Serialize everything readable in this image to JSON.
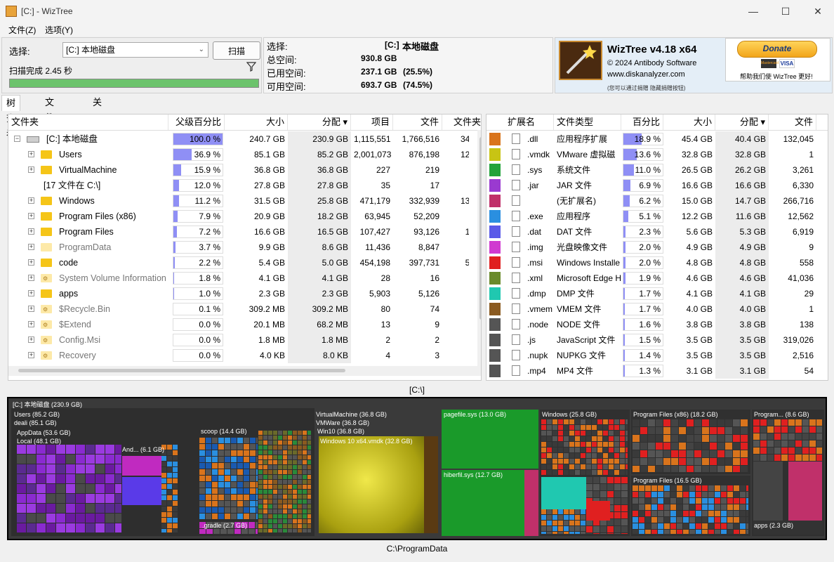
{
  "window": {
    "title": "[C:]  - WizTree",
    "minimize_icon": "minimize-icon",
    "maximize_icon": "maximize-icon",
    "close_icon": "close-icon"
  },
  "menu": [
    "文件(Z)",
    "选项(Y)"
  ],
  "scan_panel": {
    "select_label": "选择:",
    "drive_value": "[C:] 本地磁盘",
    "scan_button": "扫描",
    "status": "扫描完成 2.45 秒",
    "progress_fraction": 1.0,
    "filter_icon": "filter-icon"
  },
  "drive_info": {
    "select_label": "选择:",
    "drive_tag": "[C:]",
    "drive_name": "本地磁盘",
    "rows": [
      {
        "label": "总空间:",
        "value": "930.8 GB",
        "pct": ""
      },
      {
        "label": "已用空间:",
        "value": "237.1 GB",
        "pct": "(25.5%)"
      },
      {
        "label": "可用空间:",
        "value": "693.7 GB",
        "pct": "(74.5%)"
      }
    ]
  },
  "promo": {
    "title": "WizTree v4.18 x64",
    "copyright": "© 2024 Antibody Software",
    "website": "www.diskanalyzer.com",
    "note": "(您可以通过捐赠 隐藏捐赠按钮)",
    "donate_label": "Donate",
    "donate_caption": "帮助我们使 WizTree 更好!",
    "card_labels": [
      "Mastercard",
      "VISA"
    ]
  },
  "tabs": [
    "树查看",
    "文件查看",
    "关于"
  ],
  "tree": {
    "columns": [
      "文件夹",
      "父级百分比",
      "大小",
      "分配",
      "项目",
      "文件",
      "文件夹"
    ],
    "rows": [
      {
        "name": "[C:] 本地磁盘",
        "pct": "100.0 %",
        "pct_value": 100.0,
        "size": "240.7 GB",
        "alloc": "230.9 GB",
        "items": "1,115,551",
        "files": "1,766,516",
        "folders": "349,0",
        "depth": 0,
        "expand": "−",
        "icon": "drive-icon",
        "dim": false
      },
      {
        "name": "Users",
        "pct": "36.9 %",
        "pct_value": 36.9,
        "size": "85.1 GB",
        "alloc": "85.2 GB",
        "items": "2,001,073",
        "files": "876,198",
        "folders": "124,8",
        "depth": 1,
        "expand": "+",
        "icon": "folder-icon",
        "dim": false
      },
      {
        "name": "VirtualMachine",
        "pct": "15.9 %",
        "pct_value": 15.9,
        "size": "36.8 GB",
        "alloc": "36.8 GB",
        "items": "227",
        "files": "219",
        "folders": "",
        "depth": 1,
        "expand": "+",
        "icon": "folder-icon",
        "dim": false
      },
      {
        "name": "[17 文件在 C:\\]",
        "pct": "12.0 %",
        "pct_value": 12.0,
        "size": "27.8 GB",
        "alloc": "27.8 GB",
        "items": "35",
        "files": "17",
        "folders": "",
        "depth": 1,
        "expand": "",
        "icon": "",
        "dim": false
      },
      {
        "name": "Windows",
        "pct": "11.2 %",
        "pct_value": 11.2,
        "size": "31.5 GB",
        "alloc": "25.8 GB",
        "items": "471,179",
        "files": "332,939",
        "folders": "138,2",
        "depth": 1,
        "expand": "+",
        "icon": "folder-icon",
        "dim": false
      },
      {
        "name": "Program Files (x86)",
        "pct": "7.9 %",
        "pct_value": 7.9,
        "size": "20.9 GB",
        "alloc": "18.2 GB",
        "items": "63,945",
        "files": "52,209",
        "folders": "11,",
        "depth": 1,
        "expand": "+",
        "icon": "folder-icon",
        "dim": false
      },
      {
        "name": "Program Files",
        "pct": "7.2 %",
        "pct_value": 7.2,
        "size": "16.6 GB",
        "alloc": "16.5 GB",
        "items": "107,427",
        "files": "93,126",
        "folders": "14,3",
        "depth": 1,
        "expand": "+",
        "icon": "folder-icon",
        "dim": false
      },
      {
        "name": "ProgramData",
        "pct": "3.7 %",
        "pct_value": 3.7,
        "size": "9.9 GB",
        "alloc": "8.6 GB",
        "items": "11,436",
        "files": "8,847",
        "folders": "2,5",
        "depth": 1,
        "expand": "+",
        "icon": "folder-icon",
        "dim": true
      },
      {
        "name": "code",
        "pct": "2.2 %",
        "pct_value": 2.2,
        "size": "5.4 GB",
        "alloc": "5.0 GB",
        "items": "454,198",
        "files": "397,731",
        "folders": "56,4",
        "depth": 1,
        "expand": "+",
        "icon": "folder-icon",
        "dim": false
      },
      {
        "name": "System Volume Information",
        "pct": "1.8 %",
        "pct_value": 1.8,
        "size": "4.1 GB",
        "alloc": "4.1 GB",
        "items": "28",
        "files": "16",
        "folders": "",
        "depth": 1,
        "expand": "+",
        "icon": "system-folder-icon",
        "dim": true
      },
      {
        "name": "apps",
        "pct": "1.0 %",
        "pct_value": 1.0,
        "size": "2.3 GB",
        "alloc": "2.3 GB",
        "items": "5,903",
        "files": "5,126",
        "folders": "",
        "depth": 1,
        "expand": "+",
        "icon": "folder-icon",
        "dim": false
      },
      {
        "name": "$Recycle.Bin",
        "pct": "0.1 %",
        "pct_value": 0.1,
        "size": "309.2 MB",
        "alloc": "309.2 MB",
        "items": "80",
        "files": "74",
        "folders": "",
        "depth": 1,
        "expand": "+",
        "icon": "system-folder-icon",
        "dim": true
      },
      {
        "name": "$Extend",
        "pct": "0.0 %",
        "pct_value": 0.0,
        "size": "20.1 MB",
        "alloc": "68.2 MB",
        "items": "13",
        "files": "9",
        "folders": "",
        "depth": 1,
        "expand": "+",
        "icon": "system-folder-icon",
        "dim": true
      },
      {
        "name": "Config.Msi",
        "pct": "0.0 %",
        "pct_value": 0.0,
        "size": "1.8 MB",
        "alloc": "1.8 MB",
        "items": "2",
        "files": "2",
        "folders": "",
        "depth": 1,
        "expand": "+",
        "icon": "system-folder-icon",
        "dim": true
      },
      {
        "name": "Recovery",
        "pct": "0.0 %",
        "pct_value": 0.0,
        "size": "4.0 KB",
        "alloc": "8.0 KB",
        "items": "4",
        "files": "3",
        "folders": "",
        "depth": 1,
        "expand": "+",
        "icon": "system-folder-icon",
        "dim": true
      }
    ]
  },
  "ext": {
    "columns": [
      "扩展名",
      "文件类型",
      "百分比",
      "大小",
      "分配",
      "文件"
    ],
    "rows": [
      {
        "color": "#d9741c",
        "ext": ".dll",
        "type": "应用程序扩展",
        "pct": "18.9 %",
        "pct_value": 18.9,
        "size": "45.4 GB",
        "alloc": "40.4 GB",
        "files": "132,045"
      },
      {
        "color": "#c8c414",
        "ext": ".vmdk",
        "type": "VMware 虚拟磁",
        "pct": "13.6 %",
        "pct_value": 13.6,
        "size": "32.8 GB",
        "alloc": "32.8 GB",
        "files": "1"
      },
      {
        "color": "#22a33a",
        "ext": ".sys",
        "type": "系统文件",
        "pct": "11.0 %",
        "pct_value": 11.0,
        "size": "26.5 GB",
        "alloc": "26.2 GB",
        "files": "3,261"
      },
      {
        "color": "#9a3ad0",
        "ext": ".jar",
        "type": "JAR 文件",
        "pct": "6.9 %",
        "pct_value": 6.9,
        "size": "16.6 GB",
        "alloc": "16.6 GB",
        "files": "6,330"
      },
      {
        "color": "#c0306a",
        "ext": "",
        "type": "(无扩展名)",
        "pct": "6.2 %",
        "pct_value": 6.2,
        "size": "15.0 GB",
        "alloc": "14.7 GB",
        "files": "266,716"
      },
      {
        "color": "#2a8fe0",
        "ext": ".exe",
        "type": "应用程序",
        "pct": "5.1 %",
        "pct_value": 5.1,
        "size": "12.2 GB",
        "alloc": "11.6 GB",
        "files": "12,562"
      },
      {
        "color": "#5a5ae8",
        "ext": ".dat",
        "type": "DAT 文件",
        "pct": "2.3 %",
        "pct_value": 2.3,
        "size": "5.6 GB",
        "alloc": "5.3 GB",
        "files": "6,919"
      },
      {
        "color": "#d03ad0",
        "ext": ".img",
        "type": "光盘映像文件",
        "pct": "2.0 %",
        "pct_value": 2.0,
        "size": "4.9 GB",
        "alloc": "4.9 GB",
        "files": "9"
      },
      {
        "color": "#e02020",
        "ext": ".msi",
        "type": "Windows Installe",
        "pct": "2.0 %",
        "pct_value": 2.0,
        "size": "4.8 GB",
        "alloc": "4.8 GB",
        "files": "558"
      },
      {
        "color": "#6a8a2a",
        "ext": ".xml",
        "type": "Microsoft Edge H",
        "pct": "1.9 %",
        "pct_value": 1.9,
        "size": "4.6 GB",
        "alloc": "4.6 GB",
        "files": "41,036"
      },
      {
        "color": "#20c8b0",
        "ext": ".dmp",
        "type": "DMP 文件",
        "pct": "1.7 %",
        "pct_value": 1.7,
        "size": "4.1 GB",
        "alloc": "4.1 GB",
        "files": "29"
      },
      {
        "color": "#8a5a20",
        "ext": ".vmem",
        "type": "VMEM 文件",
        "pct": "1.7 %",
        "pct_value": 1.7,
        "size": "4.0 GB",
        "alloc": "4.0 GB",
        "files": "1"
      },
      {
        "color": "#555555",
        "ext": ".node",
        "type": "NODE 文件",
        "pct": "1.6 %",
        "pct_value": 1.6,
        "size": "3.8 GB",
        "alloc": "3.8 GB",
        "files": "138"
      },
      {
        "color": "#555555",
        "ext": ".js",
        "type": "JavaScript 文件",
        "pct": "1.5 %",
        "pct_value": 1.5,
        "size": "3.5 GB",
        "alloc": "3.5 GB",
        "files": "319,026"
      },
      {
        "color": "#555555",
        "ext": ".nupk",
        "type": "NUPKG 文件",
        "pct": "1.4 %",
        "pct_value": 1.4,
        "size": "3.5 GB",
        "alloc": "3.5 GB",
        "files": "2,516"
      },
      {
        "color": "#555555",
        "ext": ".mp4",
        "type": "MP4 文件",
        "pct": "1.3 %",
        "pct_value": 1.3,
        "size": "3.1 GB",
        "alloc": "3.1 GB",
        "files": "54"
      }
    ]
  },
  "path_top": "[C:\\]",
  "path_bottom": "C:\\ProgramData",
  "treemap": {
    "labels": [
      "[C:] 本地磁盘  (230.9 GB)",
      "Users  (85.2 GB)",
      "deali  (85.1 GB)",
      "AppData  (53.6 GB)",
      "Local  (48.1 GB)",
      "And...  (6.1 GB)",
      "scoop  (14.4 GB)",
      ".gradle  (2.7 GB)",
      "VirtualMachine  (36.8 GB)",
      "VMWare  (36.8 GB)",
      "Win10  (36.8 GB)",
      "Windows 10 x64.vmdk  (32.8 GB)",
      "pagefile.sys  (13.0 GB)",
      "hiberfil.sys  (12.7 GB)",
      "Windows  (25.8 GB)",
      "Program Files (x86)  (18.2 GB)",
      "Program Files  (16.5 GB)",
      "Program...  (8.6 GB)",
      "apps  (2.3 GB)"
    ]
  }
}
